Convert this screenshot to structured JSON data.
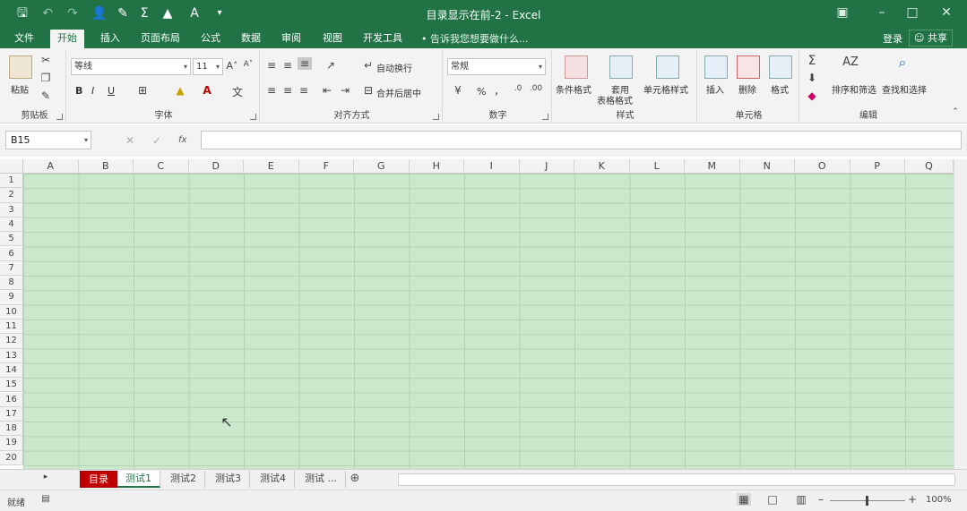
{
  "window": {
    "title": "目录显示在前-2 - Excel"
  },
  "tabs": [
    "文件",
    "开始",
    "插入",
    "页面布局",
    "公式",
    "数据",
    "审阅",
    "视图",
    "开发工具"
  ],
  "active_tab": "开始",
  "tell_me": "告诉我您想要做什么...",
  "login": "登录",
  "share": "共享",
  "ribbon": {
    "clipboard": {
      "paste": "粘贴",
      "label": "剪贴板"
    },
    "font": {
      "name": "等线",
      "size": "11",
      "bold": "B",
      "italic": "I",
      "underline": "U",
      "label": "字体"
    },
    "alignment": {
      "wrap": "自动换行",
      "merge": "合并后居中",
      "label": "对齐方式"
    },
    "number": {
      "format": "常规",
      "percent": "%",
      "comma": ",",
      "label": "数字"
    },
    "styles": {
      "conditional": "条件格式",
      "table_line1": "套用",
      "table_line2": "表格格式",
      "cell_styles": "单元格样式",
      "label": "样式"
    },
    "cells": {
      "insert": "插入",
      "delete": "删除",
      "format": "格式",
      "label": "单元格"
    },
    "editing": {
      "sort": "排序和筛选",
      "find": "查找和选择",
      "label": "编辑"
    }
  },
  "formula_bar": {
    "name_box": "B15",
    "fx": "fx",
    "formula": ""
  },
  "columns": [
    "A",
    "B",
    "C",
    "D",
    "E",
    "F",
    "G",
    "H",
    "I",
    "J",
    "K",
    "L",
    "M",
    "N",
    "O",
    "P",
    "Q"
  ],
  "rows": [
    "1",
    "2",
    "3",
    "4",
    "5",
    "6",
    "7",
    "8",
    "9",
    "10",
    "11",
    "12",
    "13",
    "14",
    "15",
    "16",
    "17",
    "18",
    "19",
    "20"
  ],
  "sheets": [
    "目录",
    "测试1",
    "测试2",
    "测试3",
    "测试4",
    "测试 ..."
  ],
  "active_sheet": "测试1",
  "status": {
    "ready": "就绪",
    "zoom": "100%"
  },
  "colors": {
    "excel_green": "#217346",
    "sheet_highlight": "#c00000",
    "cell_fill": "#cbe8cd"
  }
}
